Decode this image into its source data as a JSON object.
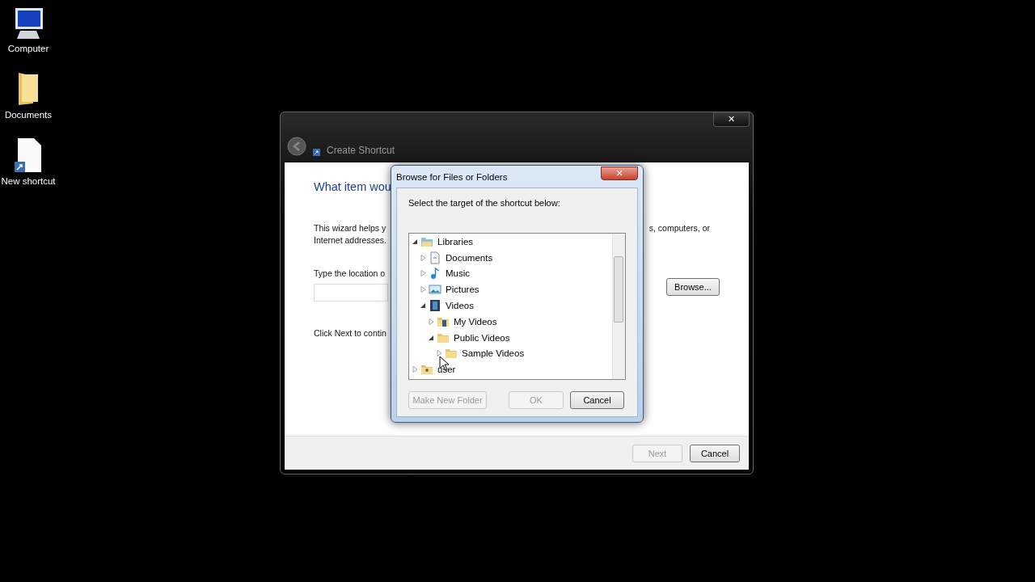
{
  "desktop_icons": [
    {
      "kind": "computer",
      "label": "Computer"
    },
    {
      "kind": "folder",
      "label": "Documents"
    },
    {
      "kind": "shortcut",
      "label": "New shortcut"
    }
  ],
  "wizard": {
    "title": "Create Shortcut",
    "close": "✕",
    "heading": "What item wou",
    "intro_left": [
      "This wizard helps y",
      "Internet addresses."
    ],
    "intro_right": "s, computers, or",
    "location_label": "Type the location o",
    "browse_button": "Browse...",
    "next_hint": "Click Next to contin",
    "buttons": [
      {
        "label": "Next",
        "disabled": true
      },
      {
        "label": "Cancel",
        "disabled": false
      }
    ]
  },
  "dialog": {
    "title": "Browse for Files or Folders",
    "close": "✕",
    "prompt": "Select the target of the shortcut below:",
    "tree": [
      {
        "label": "Libraries",
        "kind": "library",
        "expanded": true,
        "children": [
          {
            "label": "Documents",
            "kind": "documents",
            "expanded": false
          },
          {
            "label": "Music",
            "kind": "music",
            "expanded": false
          },
          {
            "label": "Pictures",
            "kind": "pictures",
            "expanded": false
          },
          {
            "label": "Videos",
            "kind": "videos",
            "expanded": true,
            "children": [
              {
                "label": "My Videos",
                "kind": "video-folder",
                "expanded": false
              },
              {
                "label": "Public Videos",
                "kind": "folder",
                "expanded": true,
                "children": [
                  {
                    "label": "Sample Videos",
                    "kind": "folder",
                    "expanded": false
                  }
                ]
              }
            ]
          }
        ]
      },
      {
        "label": "user",
        "kind": "user-folder",
        "expanded": false
      }
    ],
    "buttons": [
      {
        "label": "Make New Folder",
        "disabled": true
      },
      {
        "label": "OK",
        "disabled": true
      },
      {
        "label": "Cancel",
        "disabled": false
      }
    ]
  }
}
